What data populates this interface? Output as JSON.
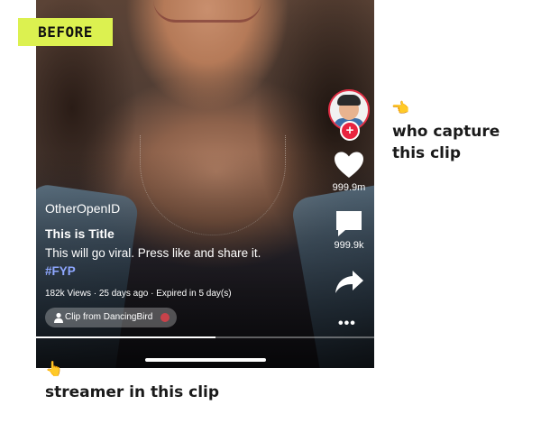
{
  "badge": {
    "label": "BEFORE"
  },
  "post": {
    "open_id": "OtherOpenID",
    "title": "This is Title",
    "description": "This will go viral. Press like and share it.",
    "hashtag": "#FYP",
    "meta": "182k Views · 25 days ago · Expired in 5 day(s)",
    "clip_from": "Clip from DancingBird"
  },
  "rail": {
    "likes": "999.9m",
    "comments": "999.9k",
    "more": "•••"
  },
  "playback": {
    "progress_fraction": 0.53
  },
  "annotations": {
    "capturer_emoji": "👈",
    "capturer_label_line1": "who capture",
    "capturer_label_line2": "this clip",
    "streamer_emoji": "👆",
    "streamer_label": "streamer in this clip"
  },
  "colors": {
    "badge_bg": "#dcf150",
    "hashtag": "#8ea7ff",
    "follow_red": "#e9243f"
  },
  "icons": [
    "heart-icon",
    "comment-icon",
    "share-icon",
    "plus-icon",
    "person-icon",
    "more-icon"
  ]
}
